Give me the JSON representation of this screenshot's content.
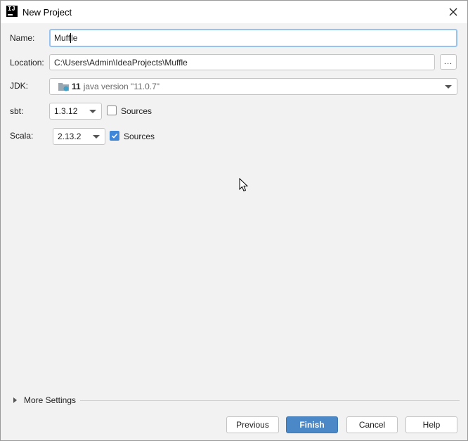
{
  "window": {
    "title": "New Project",
    "logo_text": "IJ"
  },
  "form": {
    "name": {
      "label": "Name:",
      "value_before_caret": "Muff",
      "value_after_caret": "le"
    },
    "location": {
      "label": "Location:",
      "value": "C:\\Users\\Admin\\IdeaProjects\\Muffle",
      "browse_label": "..."
    },
    "jdk": {
      "label": "JDK:",
      "version_number": "11",
      "version_text": "java version \"11.0.7\""
    },
    "sbt": {
      "label": "sbt:",
      "selected": "1.3.12",
      "sources_label": "Sources",
      "sources_checked": false
    },
    "scala": {
      "label": "Scala:",
      "selected": "2.13.2",
      "sources_label": "Sources",
      "sources_checked": true
    }
  },
  "more_settings": {
    "label": "More Settings"
  },
  "buttons": {
    "previous": "Previous",
    "finish": "Finish",
    "cancel": "Cancel",
    "help": "Help"
  },
  "colors": {
    "accent": "#4a88c7",
    "checkbox_checked": "#3f88d9",
    "focus_border": "#97c3f3"
  }
}
